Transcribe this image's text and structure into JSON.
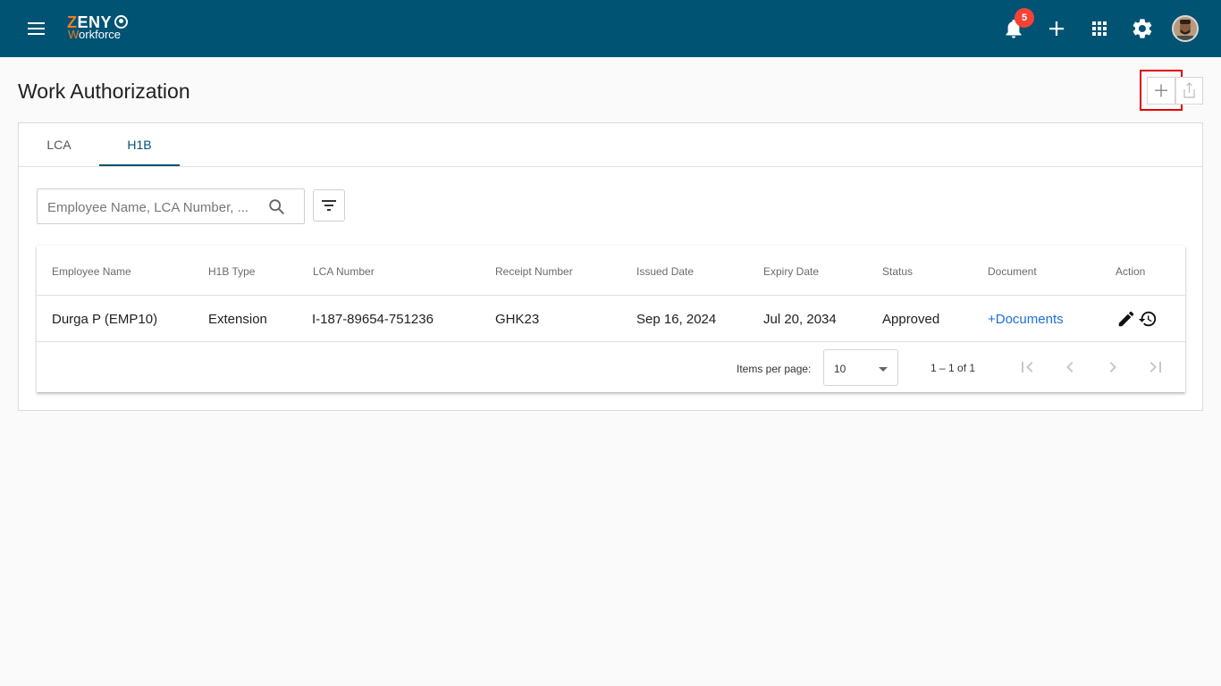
{
  "header": {
    "logo_brand_z": "Z",
    "logo_brand_rest": "ENY",
    "logo_sub_w": "W",
    "logo_sub_rest": "orkforce",
    "notification_count": "5",
    "icons": [
      "menu-icon",
      "bell-icon",
      "plus-icon",
      "apps-icon",
      "gear-icon",
      "avatar"
    ]
  },
  "page": {
    "title": "Work Authorization"
  },
  "tabs": [
    {
      "label": "LCA",
      "active": false
    },
    {
      "label": "H1B",
      "active": true
    }
  ],
  "search": {
    "placeholder": "Employee Name, LCA Number, ..."
  },
  "table": {
    "columns": [
      "Employee Name",
      "H1B Type",
      "LCA Number",
      "Receipt Number",
      "Issued Date",
      "Expiry Date",
      "Status",
      "Document",
      "Action"
    ],
    "rows": [
      {
        "employee_name": "Durga P (EMP10)",
        "h1b_type": "Extension",
        "lca_number": "I-187-89654-751236",
        "receipt_number": "GHK23",
        "issued_date": "Sep 16, 2024",
        "expiry_date": "Jul 20, 2034",
        "status": "Approved",
        "document": "+Documents"
      }
    ]
  },
  "paginator": {
    "items_per_page_label": "Items per page:",
    "items_per_page_value": "10",
    "range": "1 – 1 of 1"
  },
  "colors": {
    "topbar": "#005373",
    "accent": "#005373",
    "badge": "#f44336",
    "link": "#1e6fd9",
    "highlight": "#e00000"
  }
}
